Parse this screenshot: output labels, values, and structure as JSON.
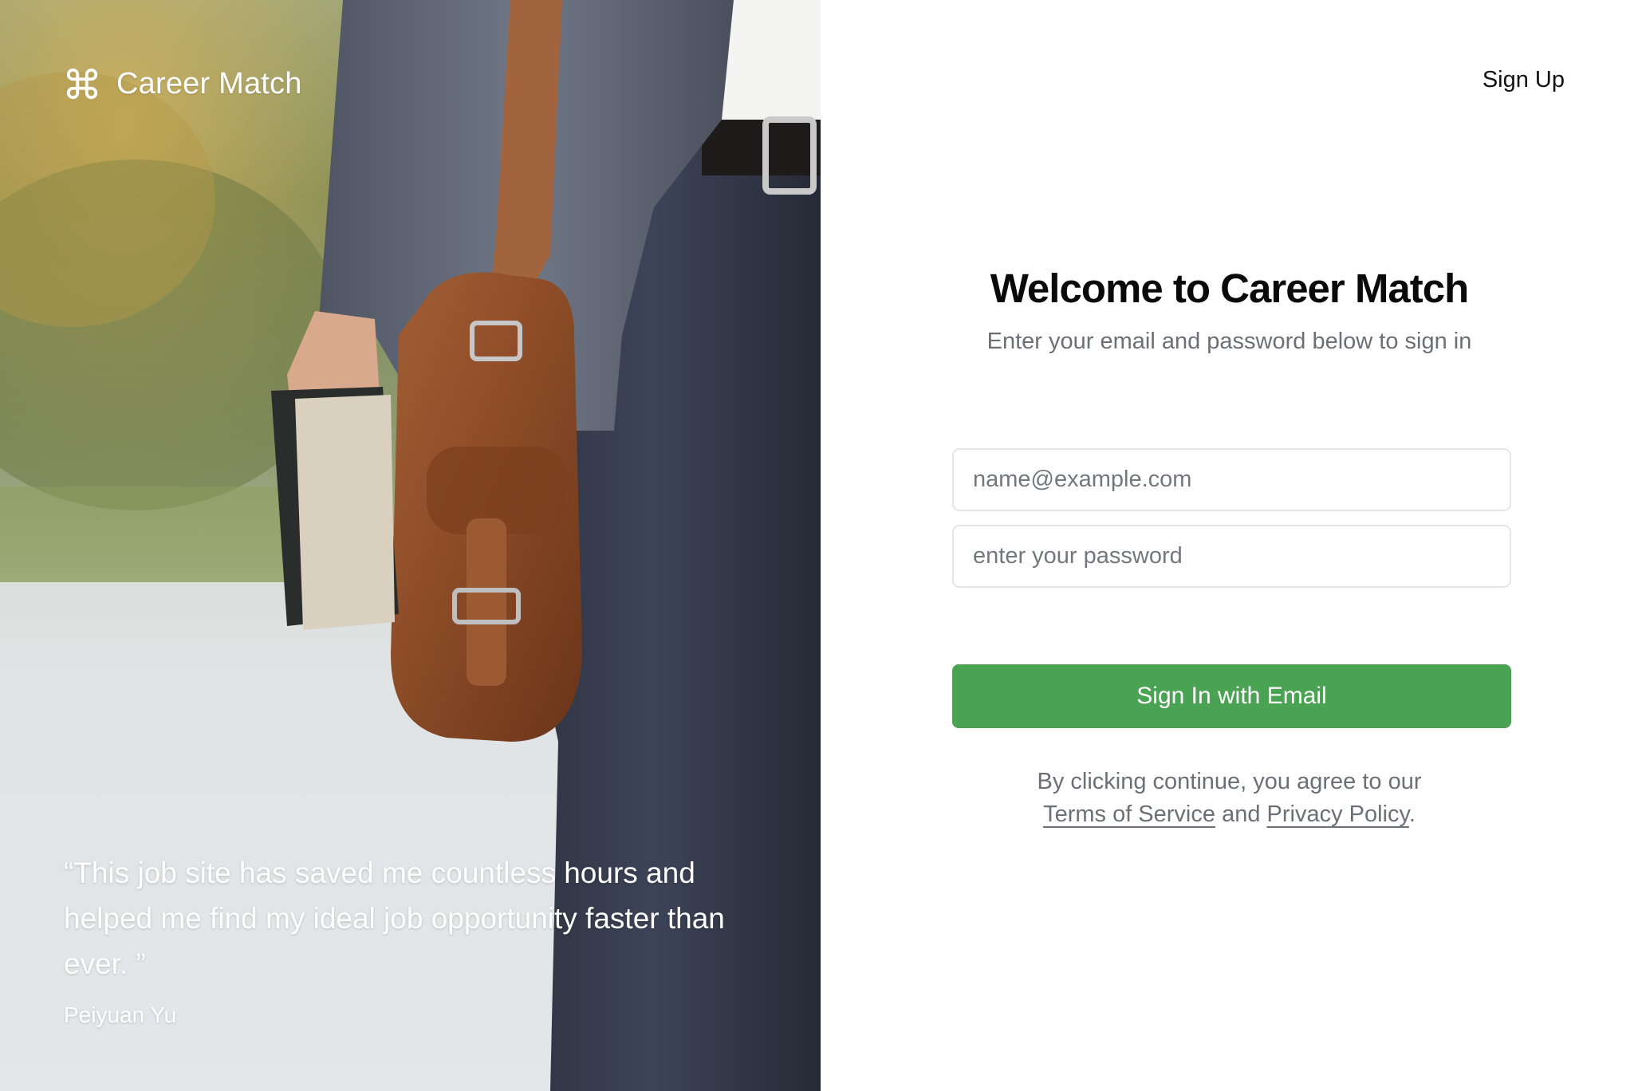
{
  "brand": {
    "name": "Career Match",
    "icon": "command-icon"
  },
  "hero": {
    "image": "man-with-leather-bag-and-book-photo",
    "quote": "“This job site has saved me countless hours and helped me find my ideal job opportunity faster than ever. ”",
    "author": "Peiyuan Yu"
  },
  "header": {
    "signup_label": "Sign Up"
  },
  "form": {
    "title": "Welcome to Career Match",
    "subtitle": "Enter your email and password below to sign in",
    "email_placeholder": "name@example.com",
    "email_value": "",
    "password_placeholder": "enter your password",
    "password_value": "",
    "submit_label": "Sign In with Email"
  },
  "legal": {
    "prefix": "By clicking continue, you agree to our",
    "terms_label": "Terms of Service",
    "and": "and",
    "privacy_label": "Privacy Policy",
    "suffix": "."
  },
  "colors": {
    "accent": "#4aa253",
    "muted_text": "#6b6f76",
    "input_border": "#e3e5e8"
  }
}
